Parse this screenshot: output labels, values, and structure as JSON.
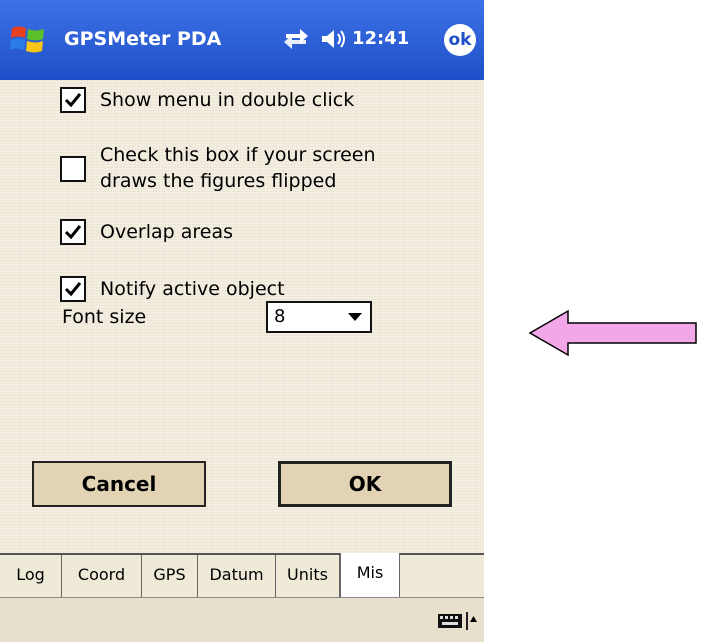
{
  "titlebar": {
    "app_title": "GPSMeter PDA",
    "time": "12:41",
    "ok_label": "ok",
    "start_icon": "windows-flag-icon",
    "sync_icon": "sync-icon",
    "volume_icon": "volume-icon",
    "color": "#2a5fd8"
  },
  "options": [
    {
      "label": "Show menu in double click",
      "checked": true
    },
    {
      "label_line1": "Check this box if your screen",
      "label_line2": "draws the figures flipped",
      "checked": false
    },
    {
      "label": "Overlap areas",
      "checked": true
    },
    {
      "label": "Notify active object",
      "checked": true
    }
  ],
  "font_size": {
    "label": "Font size",
    "value": "8"
  },
  "buttons": {
    "cancel": "Cancel",
    "ok": "OK"
  },
  "tabs": [
    {
      "label": "Log",
      "active": false
    },
    {
      "label": "Coord",
      "active": false
    },
    {
      "label": "GPS",
      "active": false
    },
    {
      "label": "Datum",
      "active": false
    },
    {
      "label": "Units",
      "active": false
    },
    {
      "label": "Mis",
      "active": true
    }
  ],
  "bottombar": {
    "keyboard_icon": "keyboard-icon",
    "arrow_icon": "up-arrow-icon"
  },
  "annotation": {
    "arrow_color": "#f2a8e8",
    "arrow_direction": "left"
  }
}
